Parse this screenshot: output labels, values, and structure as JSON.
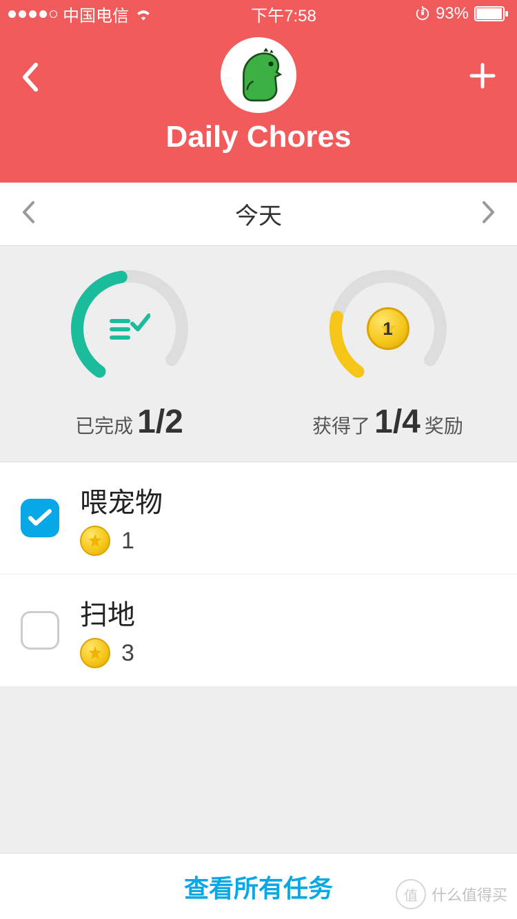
{
  "status": {
    "carrier": "中国电信",
    "time": "下午7:58",
    "battery": "93%"
  },
  "header": {
    "title": "Daily Chores"
  },
  "dateNav": {
    "label": "今天"
  },
  "progress": {
    "completed": {
      "prefix": "已完成",
      "value": "1/2"
    },
    "rewards": {
      "prefix": "获得了",
      "value": "1/4",
      "suffix": "奖励",
      "coin_badge": "1"
    }
  },
  "tasks": [
    {
      "title": "喂宠物",
      "reward": "1",
      "done": true
    },
    {
      "title": "扫地",
      "reward": "3",
      "done": false
    }
  ],
  "footer": {
    "link": "查看所有任务"
  },
  "watermark": {
    "logo": "值",
    "text": "什么值得买"
  }
}
